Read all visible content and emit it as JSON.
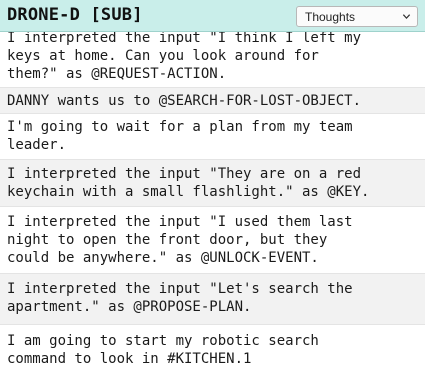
{
  "header": {
    "title": "DRONE-D [SUB]",
    "filter": {
      "selected": "Thoughts",
      "icon": "chevron-down-icon"
    }
  },
  "log": {
    "entries": [
      {
        "text": "I interpreted the input \"I think I left my\nkeys at home. Can you look around for\nthem?\" as @REQUEST-ACTION.",
        "shaded": false
      },
      {
        "text": "DANNY wants us to @SEARCH-FOR-LOST-OBJECT.",
        "shaded": true
      },
      {
        "text": "I'm going to wait for a plan from my team\nleader.",
        "shaded": false
      },
      {
        "text": "I interpreted the input \"They are on a red\nkeychain with a small flashlight.\" as @KEY.",
        "shaded": true
      },
      {
        "text": "I interpreted the input \"I used them last\nnight to open the front door, but they\ncould be anywhere.\" as @UNLOCK-EVENT.",
        "shaded": false
      },
      {
        "text": "I interpreted the input \"Let's search the\napartment.\" as @PROPOSE-PLAN.",
        "shaded": true
      },
      {
        "text": "I am going to start my robotic search\ncommand to look in #KITCHEN.1",
        "shaded": false
      }
    ]
  }
}
